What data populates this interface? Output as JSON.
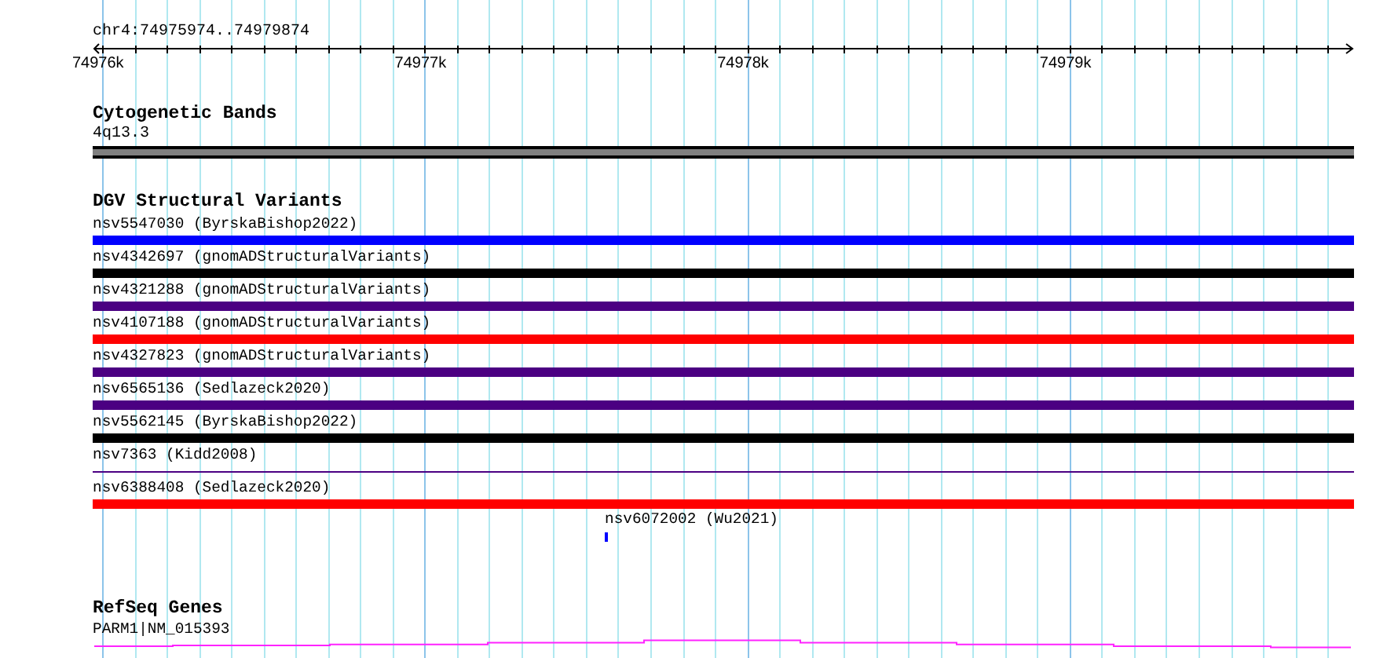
{
  "ruler": {
    "location": "chr4:74975974..74979874",
    "ticks": [
      "74976k",
      "74977k",
      "74978k",
      "74979k"
    ]
  },
  "tracks": [
    {
      "kind": "cytoband",
      "title": "Cytogenetic Bands",
      "features": [
        {
          "label": "4q13.3",
          "color": "#808080"
        }
      ]
    },
    {
      "kind": "variants",
      "title": "DGV Structural Variants",
      "features": [
        {
          "label": "nsv5547030 (ByrskaBishop2022)",
          "kind": "bar",
          "color": "#0000ff"
        },
        {
          "label": "nsv4342697 (gnomADStructuralVariants)",
          "kind": "bar",
          "color": "#000000"
        },
        {
          "label": "nsv4321288 (gnomADStructuralVariants)",
          "kind": "bar",
          "color": "#4b0082"
        },
        {
          "label": "nsv4107188 (gnomADStructuralVariants)",
          "kind": "bar",
          "color": "#ff0000"
        },
        {
          "label": "nsv4327823 (gnomADStructuralVariants)",
          "kind": "bar",
          "color": "#4b0082"
        },
        {
          "label": "nsv6565136 (Sedlazeck2020)",
          "kind": "bar",
          "color": "#4b0082"
        },
        {
          "label": "nsv5562145 (ByrskaBishop2022)",
          "kind": "bar",
          "color": "#000000"
        },
        {
          "label": "nsv7363 (Kidd2008)",
          "kind": "line",
          "color": "#4b0082"
        },
        {
          "label": "nsv6388408 (Sedlazeck2020)",
          "kind": "bar",
          "color": "#ff0000"
        },
        {
          "label": "nsv6072002 (Wu2021)",
          "kind": "point",
          "color": "#0000ff"
        }
      ]
    },
    {
      "kind": "genes",
      "title": "RefSeq Genes",
      "features": [
        {
          "label": "PARM1|NM_015393",
          "color": "#ff22ff"
        }
      ]
    }
  ]
}
